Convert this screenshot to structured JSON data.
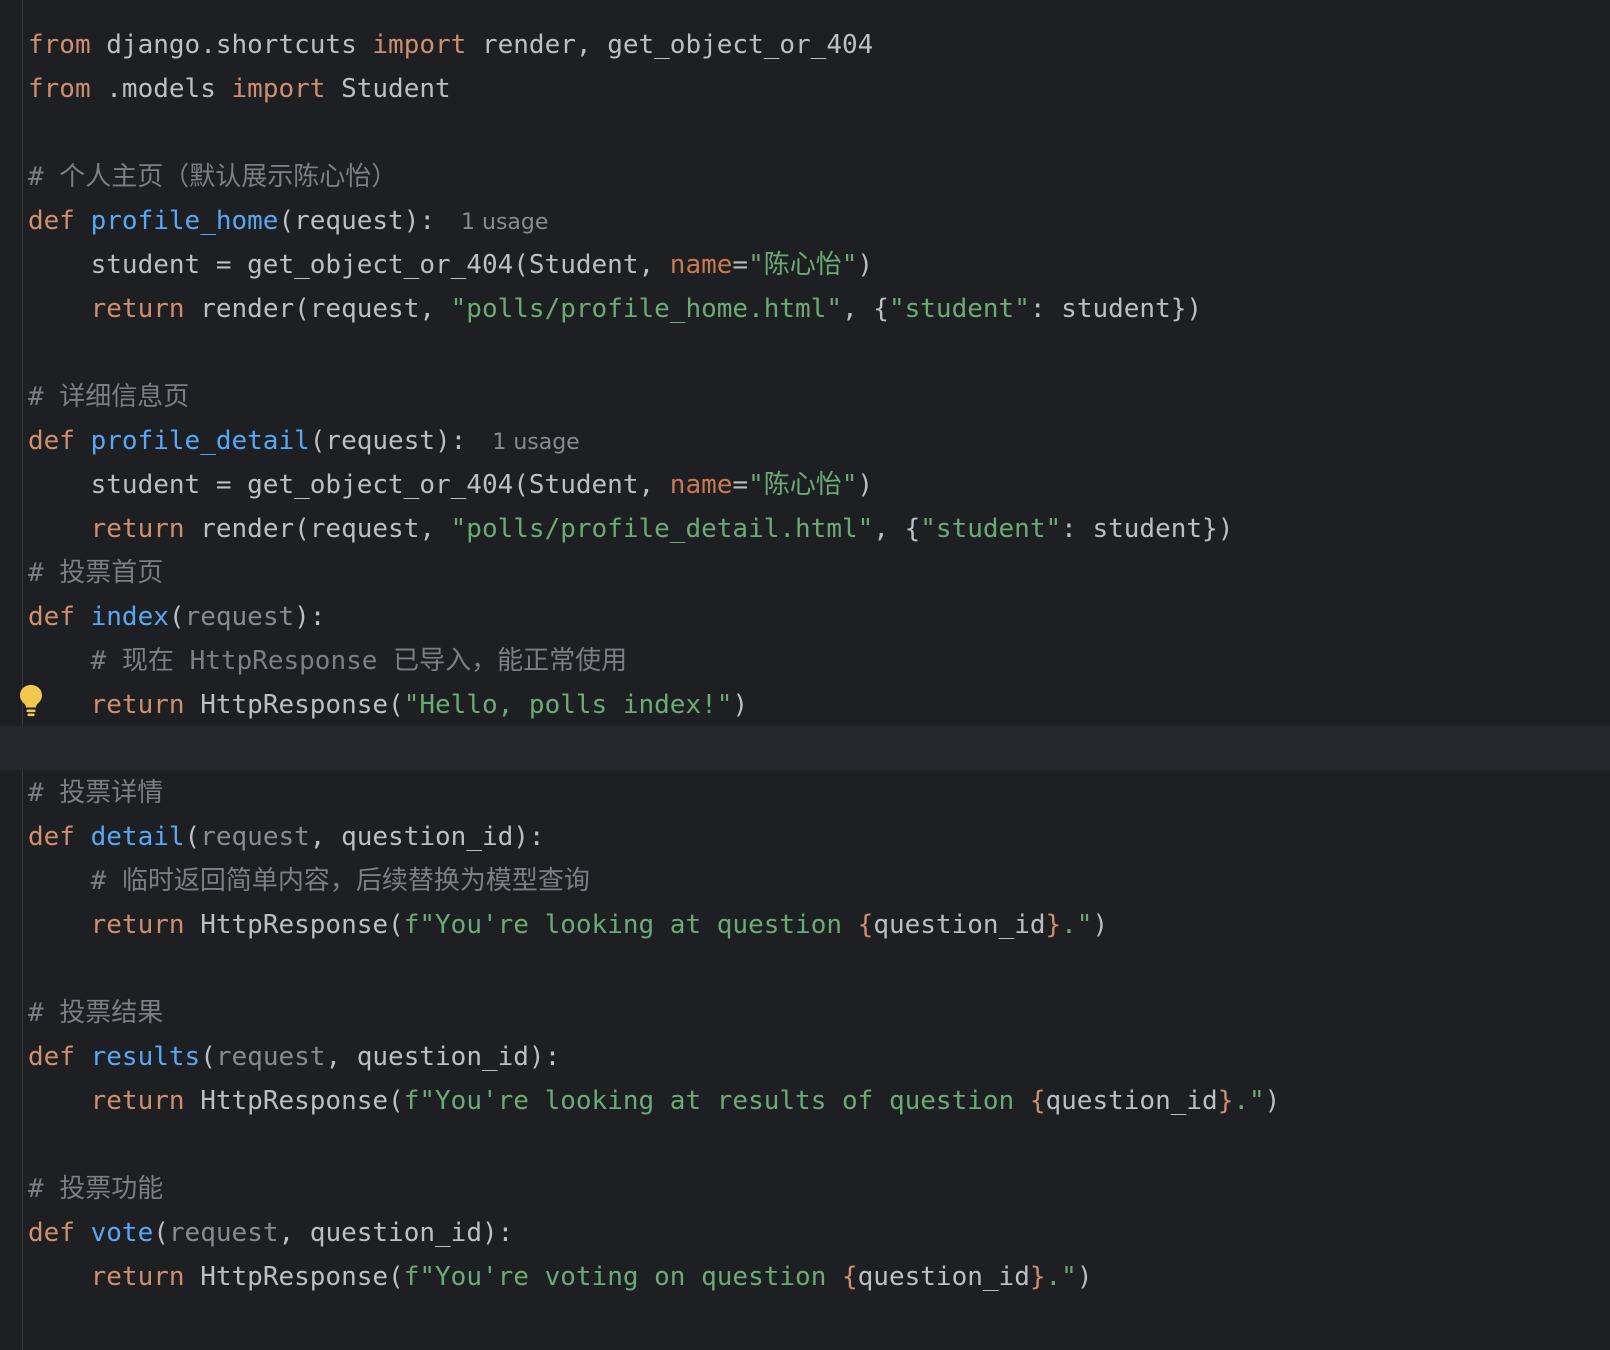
{
  "editor": {
    "usage_hint": "1 usage",
    "lines": {
      "l1": {
        "a": "from",
        "b": " django.shortcuts ",
        "c": "import",
        "d": " render, get_object_or_404"
      },
      "l2": {
        "a": "from",
        "b": " .models ",
        "c": "import",
        "d": " Student"
      },
      "l4": "# 个人主页（默认展示陈心怡）",
      "l5": {
        "a": "def",
        "b": "profile_home",
        "c": "(request):"
      },
      "l6": {
        "a": "    student = get_object_or_404(Student, ",
        "b": "name",
        "c": "=",
        "d": "\"陈心怡\"",
        "e": ")"
      },
      "l7": {
        "a": "    ",
        "b": "return",
        "c": " render(request, ",
        "d": "\"polls/profile_home.html\"",
        "e": ", {",
        "f": "\"student\"",
        "g": ": student})"
      },
      "l9": "# 详细信息页",
      "l10": {
        "a": "def",
        "b": "profile_detail",
        "c": "(request):"
      },
      "l11": {
        "a": "    student = get_object_or_404(Student, ",
        "b": "name",
        "c": "=",
        "d": "\"陈心怡\"",
        "e": ")"
      },
      "l12": {
        "a": "    ",
        "b": "return",
        "c": " render(request, ",
        "d": "\"polls/profile_detail.html\"",
        "e": ", {",
        "f": "\"student\"",
        "g": ": student})"
      },
      "l13": "# 投票首页",
      "l14": {
        "a": "def",
        "b": "index",
        "c": "(",
        "d": "request",
        "e": "):"
      },
      "l15": "    # 现在 HttpResponse 已导入，能正常使用",
      "l16": {
        "a": "    ",
        "b": "return",
        "c": " HttpResponse(",
        "d": "\"Hello, polls index!\"",
        "e": ")"
      },
      "l18": "# 投票详情",
      "l19": {
        "a": "def",
        "b": "detail",
        "c": "(",
        "d": "request",
        "e": ", question_id):"
      },
      "l20": "    # 临时返回简单内容，后续替换为模型查询",
      "l21": {
        "a": "    ",
        "b": "return",
        "c": " HttpResponse(",
        "d": "f\"You're looking at question ",
        "e": "{",
        "f": "question_id",
        "g": "}",
        "h": ".\"",
        "i": ")"
      },
      "l23": "# 投票结果",
      "l24": {
        "a": "def",
        "b": "results",
        "c": "(",
        "d": "request",
        "e": ", question_id):"
      },
      "l25": {
        "a": "    ",
        "b": "return",
        "c": " HttpResponse(",
        "d": "f\"You're looking at results of question ",
        "e": "{",
        "f": "question_id",
        "g": "}",
        "h": ".\"",
        "i": ")"
      },
      "l27": "# 投票功能",
      "l28": {
        "a": "def",
        "b": "vote",
        "c": "(",
        "d": "request",
        "e": ", question_id):"
      },
      "l29": {
        "a": "    ",
        "b": "return",
        "c": " HttpResponse(",
        "d": "f\"You're voting on question ",
        "e": "{",
        "f": "question_id",
        "g": "}",
        "h": ".\"",
        "i": ")"
      }
    },
    "colors": {
      "background": "#1e1f22",
      "keyword": "#cf8e6d",
      "function": "#56a8f5",
      "string": "#6aab73",
      "comment": "#7a7e85",
      "text": "#bcbec4"
    },
    "icons": {
      "gutter": "lightbulb-icon"
    }
  }
}
